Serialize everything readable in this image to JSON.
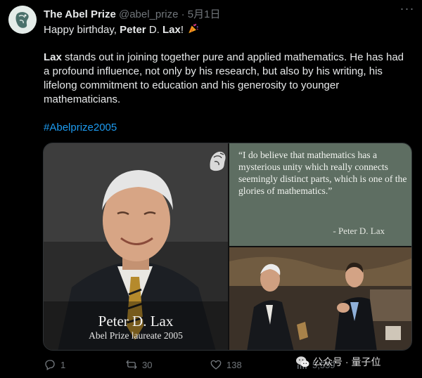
{
  "tweet": {
    "display_name": "The Abel Prize",
    "handle": "@abel_prize",
    "separator": "·",
    "date": "5月1日",
    "more_icon": "more-horizontal-icon",
    "greeting_prefix": "Happy birthday, ",
    "greeting_name_bold": "Peter",
    "greeting_name_mid": " D. ",
    "greeting_name_bold2": "Lax",
    "greeting_suffix": "!",
    "party_icon": "party-popper-icon",
    "body_bold": "Lax",
    "body_rest": " stands out in joining together pure and applied mathematics. He has had a profound influence, not only by his research, but also by his writing, his lifelong commitment to education and his generosity to younger mathematicians.",
    "hashtag": "#Abelprize2005"
  },
  "media": {
    "caption_name": "Peter D. Lax",
    "caption_sub": "Abel Prize laureate 2005",
    "quote": "“I do believe that mathematics has a mysterious unity which really connects seemingly distinct parts, which is one of the glories of mathematics.”",
    "quote_author": "- Peter D. Lax"
  },
  "actions": {
    "reply_count": "1",
    "retweet_count": "30",
    "like_count": "138",
    "views_count": "5,559"
  },
  "watermark": {
    "text": "公众号 · 量子位"
  },
  "colors": {
    "background": "#000000",
    "text": "#e7e9ea",
    "muted": "#71767b",
    "link": "#1d9bf0",
    "quote_panel": "#5e6e62"
  }
}
